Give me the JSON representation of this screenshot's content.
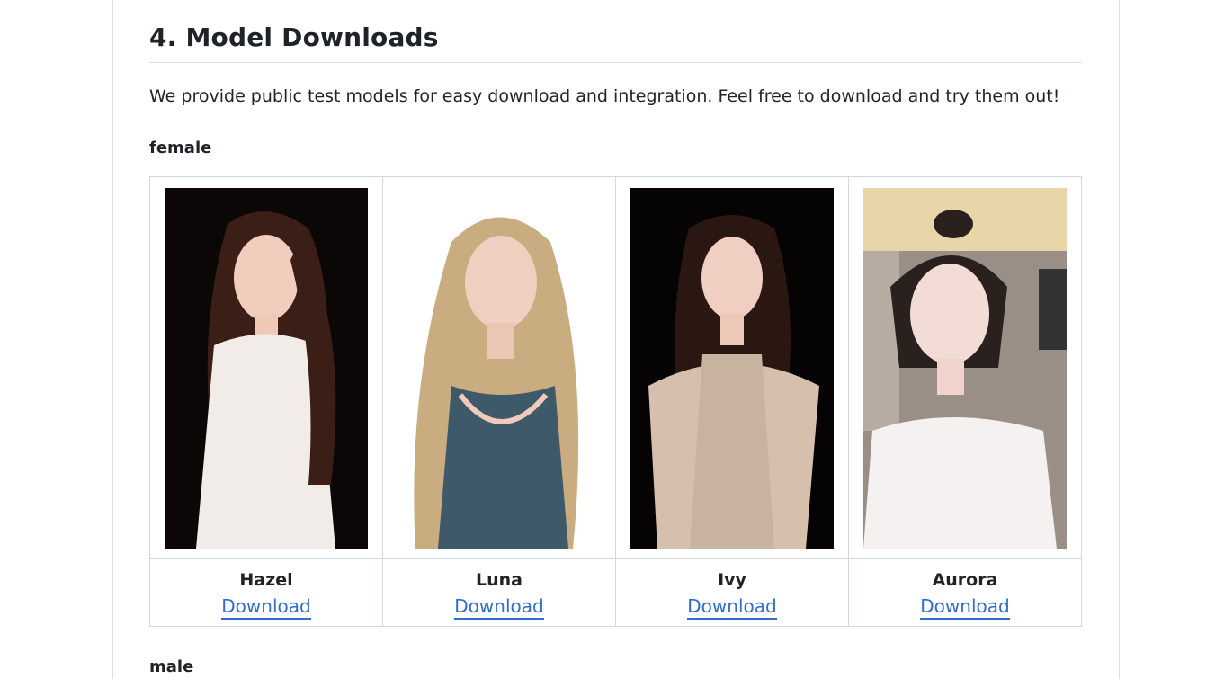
{
  "section": {
    "title": "4. Model Downloads",
    "intro": "We provide public test models for easy download and integration. Feel free to download and try them out!"
  },
  "groups": {
    "female": "female",
    "male": "male"
  },
  "models": [
    {
      "name": "Hazel",
      "download_label": "Download",
      "background": "#0b0706",
      "outfit": "#f2ece9",
      "hair": "#3b1f17"
    },
    {
      "name": "Luna",
      "download_label": "Download",
      "background": "#ffffff",
      "outfit": "#3e5a6a",
      "hair": "#c9ad80"
    },
    {
      "name": "Ivy",
      "download_label": "Download",
      "background": "#050303",
      "outfit": "#d7bfae",
      "hair": "#2b1712"
    },
    {
      "name": "Aurora",
      "download_label": "Download",
      "background": "#9a8f86",
      "outfit": "#f4f1f0",
      "hair": "#2a201e"
    }
  ]
}
